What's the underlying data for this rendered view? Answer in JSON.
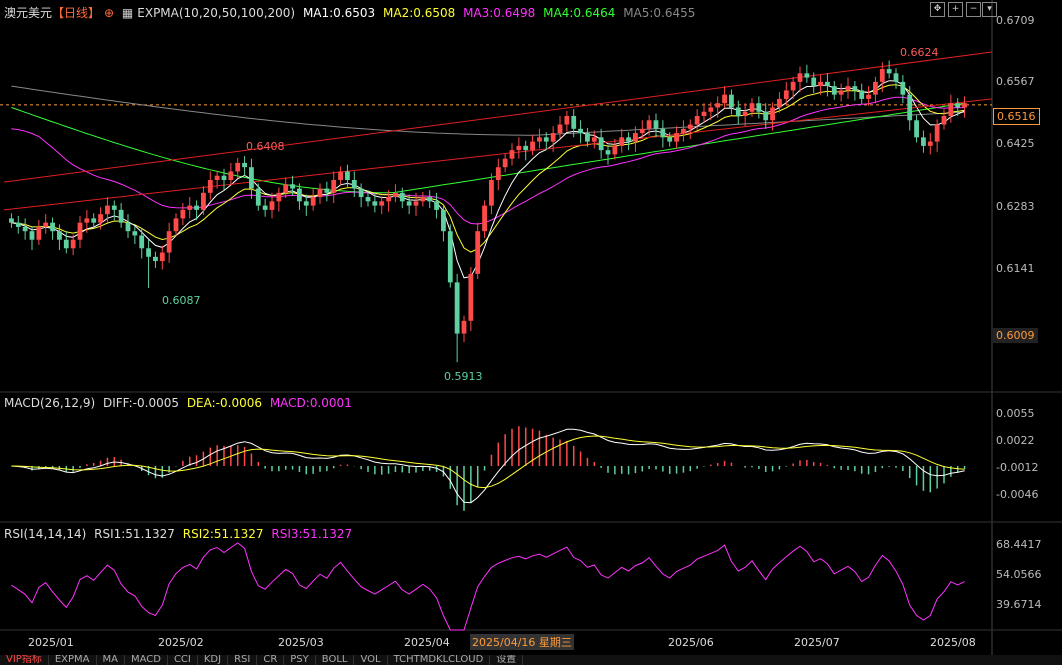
{
  "header": {
    "symbol": "澳元美元",
    "period": "【日线】",
    "indicator": "EXPMA(10,20,50,100,200)",
    "ma1": "MA1:0.6503",
    "ma2": "MA2:0.6508",
    "ma3": "MA3:0.6498",
    "ma4": "MA4:0.6464",
    "ma5": "MA5:0.6455"
  },
  "colors": {
    "ma1": "#ffffff",
    "ma2": "#ffff33",
    "ma3": "#ff33ff",
    "ma4": "#33ff33",
    "ma5": "#888888",
    "up": "#ff4a4a",
    "down": "#5fd0a0"
  },
  "price_axis": [
    "0.6709",
    "0.6567",
    "0.6425",
    "0.6283",
    "0.6141",
    "0.6009"
  ],
  "current_price": "0.6516",
  "low_tag": "0.6009",
  "annotations": {
    "high": "0.6624",
    "mid_high": "0.6408",
    "low1": "0.6087",
    "low2": "0.5913"
  },
  "macd": {
    "title": "MACD(26,12,9)",
    "diff": "DIFF:-0.0005",
    "dea": "DEA:-0.0006",
    "macd": "MACD:0.0001",
    "axis": [
      "0.0055",
      "0.0022",
      "-0.0012",
      "-0.0046"
    ]
  },
  "rsi": {
    "title": "RSI(14,14,14)",
    "rsi1": "RSI1:51.1327",
    "rsi2": "RSI2:51.1327",
    "rsi3": "RSI3:51.1327",
    "axis": [
      "68.4417",
      "54.0566",
      "39.6714"
    ]
  },
  "x_axis": [
    "2025/01",
    "2025/02",
    "2025/03",
    "2025/04",
    "2025/04/16 星期三",
    "2025/06",
    "2025/07",
    "2025/08"
  ],
  "tabs": [
    "VIP指标",
    "EXPMA",
    "MA",
    "MACD",
    "CCI",
    "KDJ",
    "RSI",
    "CR",
    "PSY",
    "BOLL",
    "VOL",
    "TCHTMDKLCLOUD",
    "设置"
  ],
  "chart_data": {
    "type": "candlestick",
    "ylim": [
      0.5913,
      0.6709
    ],
    "key_levels": {
      "high": 0.6624,
      "mid_high": 0.6408,
      "low1": 0.6087,
      "low2": 0.5913,
      "last": 0.6516
    },
    "closes": [
      0.624,
      0.623,
      0.622,
      0.62,
      0.623,
      0.624,
      0.622,
      0.62,
      0.618,
      0.62,
      0.624,
      0.625,
      0.624,
      0.626,
      0.628,
      0.627,
      0.624,
      0.622,
      0.621,
      0.618,
      0.616,
      0.615,
      0.617,
      0.622,
      0.625,
      0.627,
      0.628,
      0.627,
      0.631,
      0.634,
      0.635,
      0.634,
      0.636,
      0.638,
      0.637,
      0.632,
      0.628,
      0.627,
      0.629,
      0.631,
      0.633,
      0.632,
      0.629,
      0.628,
      0.63,
      0.632,
      0.631,
      0.634,
      0.636,
      0.634,
      0.632,
      0.63,
      0.629,
      0.628,
      0.629,
      0.63,
      0.631,
      0.629,
      0.628,
      0.629,
      0.63,
      0.629,
      0.627,
      0.622,
      0.61,
      0.598,
      0.601,
      0.612,
      0.622,
      0.628,
      0.634,
      0.637,
      0.639,
      0.641,
      0.642,
      0.641,
      0.643,
      0.644,
      0.643,
      0.645,
      0.647,
      0.649,
      0.646,
      0.645,
      0.643,
      0.644,
      0.641,
      0.64,
      0.642,
      0.644,
      0.643,
      0.645,
      0.646,
      0.648,
      0.646,
      0.644,
      0.643,
      0.645,
      0.646,
      0.647,
      0.649,
      0.65,
      0.651,
      0.652,
      0.654,
      0.651,
      0.649,
      0.65,
      0.652,
      0.65,
      0.648,
      0.651,
      0.653,
      0.655,
      0.657,
      0.659,
      0.658,
      0.656,
      0.657,
      0.656,
      0.654,
      0.655,
      0.656,
      0.655,
      0.653,
      0.654,
      0.657,
      0.66,
      0.659,
      0.657,
      0.654,
      0.648,
      0.644,
      0.642,
      0.643,
      0.647,
      0.649,
      0.652,
      0.651,
      0.652
    ]
  }
}
